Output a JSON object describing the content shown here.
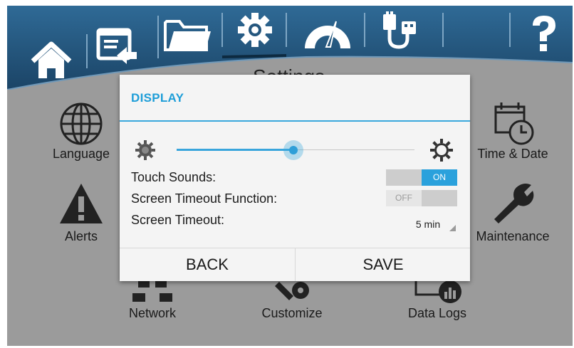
{
  "top_nav": {
    "items": [
      {
        "icon": "home-icon"
      },
      {
        "icon": "screen-back-icon"
      },
      {
        "icon": "folder-icon"
      },
      {
        "icon": "gear-icon"
      },
      {
        "icon": "gauge-icon"
      },
      {
        "icon": "usb-cable-icon"
      },
      {
        "icon": "help-icon"
      }
    ]
  },
  "page": {
    "title": "Settings"
  },
  "tiles": {
    "language": "Language",
    "time_date": "Time & Date",
    "alerts": "Alerts",
    "maintenance": "Maintenance",
    "network": "Network",
    "customize": "Customize",
    "data_logs": "Data Logs"
  },
  "dialog": {
    "title": "DISPLAY",
    "brightness": {
      "level": 0.49,
      "min_icon": "brightness-low-icon",
      "max_icon": "brightness-high-icon"
    },
    "touch_sounds": {
      "label": "Touch Sounds:",
      "state": "ON"
    },
    "screen_timeout_function": {
      "label": "Screen Timeout Function:",
      "state": "OFF"
    },
    "screen_timeout": {
      "label": "Screen Timeout:",
      "value": "5 min"
    },
    "back_label": "BACK",
    "save_label": "SAVE"
  },
  "colors": {
    "accent": "#2aa1dc",
    "topbar_dark": "#1f4f73",
    "background": "#9b9b9b",
    "dialog_bg": "#f4f4f4"
  }
}
